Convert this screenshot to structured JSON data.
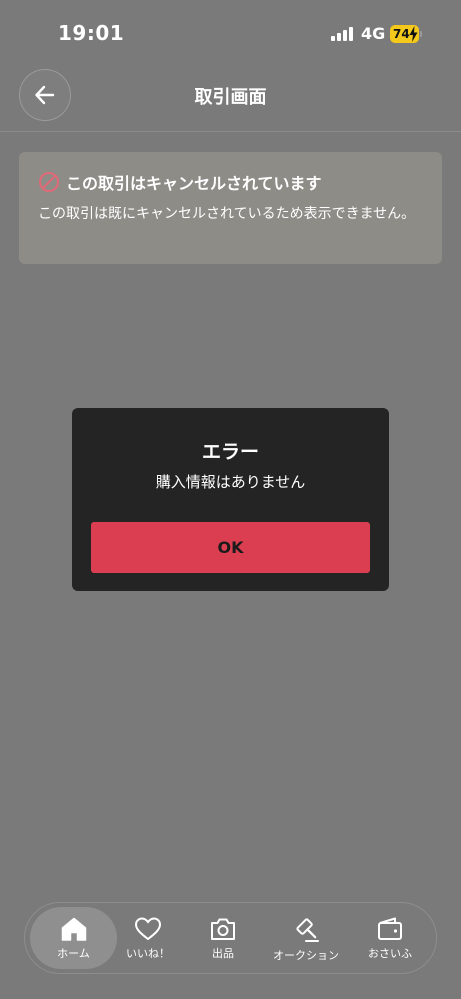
{
  "status_bar": {
    "time": "19:01",
    "network": "4G",
    "battery": "74"
  },
  "header": {
    "title": "取引画面"
  },
  "notice": {
    "title": "この取引はキャンセルされています",
    "body": "この取引は既にキャンセルされているため表示できません。"
  },
  "dialog": {
    "title": "エラー",
    "message": "購入情報はありません",
    "ok_label": "OK"
  },
  "bottom_nav": {
    "items": [
      {
        "label": "ホーム",
        "icon": "home-icon",
        "active": true
      },
      {
        "label": "いいね！",
        "icon": "heart-icon",
        "active": false
      },
      {
        "label": "出品",
        "icon": "camera-icon",
        "active": false
      },
      {
        "label": "オークション",
        "icon": "gavel-icon",
        "active": false
      },
      {
        "label": "おさいふ",
        "icon": "wallet-icon",
        "active": false
      }
    ]
  },
  "colors": {
    "accent": "#dc3e51",
    "overlay": "#7a7a7a",
    "dialog_bg": "#242424",
    "battery": "#f4c91b"
  }
}
